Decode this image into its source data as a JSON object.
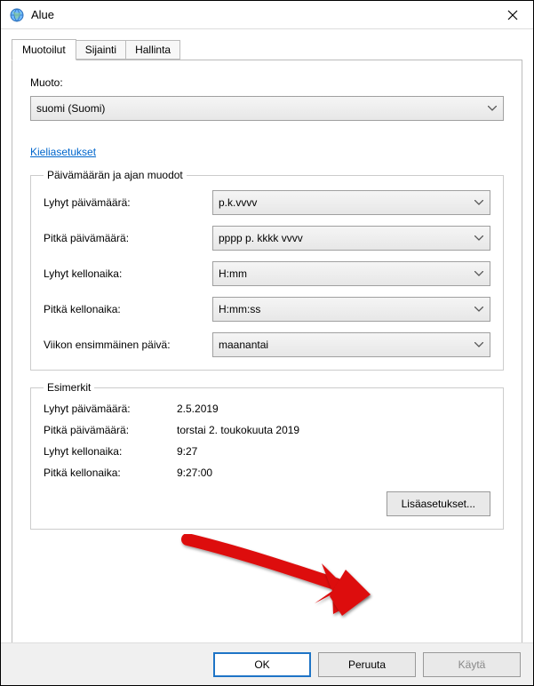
{
  "window": {
    "title": "Alue"
  },
  "tabs": [
    "Muotoilut",
    "Sijainti",
    "Hallinta"
  ],
  "muoto": {
    "label": "Muoto:",
    "value": "suomi (Suomi)"
  },
  "language_settings_link": "Kieliasetukset",
  "formats": {
    "legend": "Päivämäärän ja ajan muodot",
    "rows": [
      {
        "label": "Lyhyt päivämäärä:",
        "value": "p.k.vvvv"
      },
      {
        "label": "Pitkä päivämäärä:",
        "value": "pppp p. kkkk vvvv"
      },
      {
        "label": "Lyhyt kellonaika:",
        "value": "H:mm"
      },
      {
        "label": "Pitkä kellonaika:",
        "value": "H:mm:ss"
      },
      {
        "label": "Viikon ensimmäinen päivä:",
        "value": "maanantai"
      }
    ]
  },
  "examples": {
    "legend": "Esimerkit",
    "rows": [
      {
        "label": "Lyhyt päivämäärä:",
        "value": "2.5.2019"
      },
      {
        "label": "Pitkä päivämäärä:",
        "value": "torstai 2. toukokuuta 2019"
      },
      {
        "label": "Lyhyt kellonaika:",
        "value": "9:27"
      },
      {
        "label": "Pitkä kellonaika:",
        "value": "9:27:00"
      }
    ]
  },
  "additional_button": "Lisäasetukset...",
  "footer": {
    "ok": "OK",
    "cancel": "Peruuta",
    "apply": "Käytä"
  }
}
